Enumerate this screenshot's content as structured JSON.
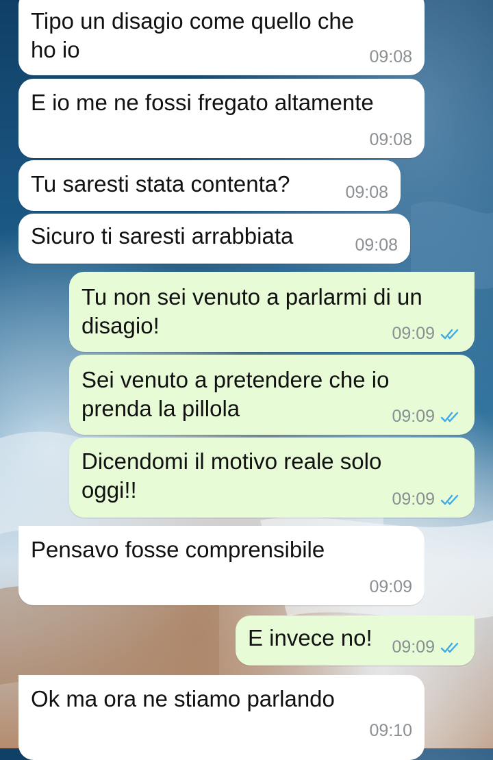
{
  "colors": {
    "incoming_bubble": "#ffffff",
    "outgoing_bubble": "#e7fbd6",
    "timestamp": "#8a8f92",
    "read_ticks": "#3fa9e6"
  },
  "messages": [
    {
      "direction": "incoming",
      "text": "Tipo un disagio come quello che\nho io",
      "time": "09:08"
    },
    {
      "direction": "incoming",
      "text": "E io me ne fossi fregato altamente",
      "time": "09:08"
    },
    {
      "direction": "incoming",
      "text": "Tu saresti stata contenta?",
      "time": "09:08"
    },
    {
      "direction": "incoming",
      "text": "Sicuro ti saresti arrabbiata",
      "time": "09:08"
    },
    {
      "direction": "outgoing",
      "text": "Tu non sei venuto a parlarmi di un\ndisagio!",
      "time": "09:09",
      "status": "read-double-check-icon"
    },
    {
      "direction": "outgoing",
      "text": "Sei venuto a pretendere che io\nprenda la pillola",
      "time": "09:09",
      "status": "read-double-check-icon"
    },
    {
      "direction": "outgoing",
      "text": "Dicendomi il motivo reale solo\noggi!!",
      "time": "09:09",
      "status": "read-double-check-icon"
    },
    {
      "direction": "incoming",
      "text": "Pensavo fosse comprensibile",
      "time": "09:09"
    },
    {
      "direction": "outgoing",
      "text": "E invece no!",
      "time": "09:09",
      "status": "read-double-check-icon"
    },
    {
      "direction": "incoming",
      "text": "Ok ma ora ne stiamo parlando",
      "time": "09:10"
    }
  ]
}
